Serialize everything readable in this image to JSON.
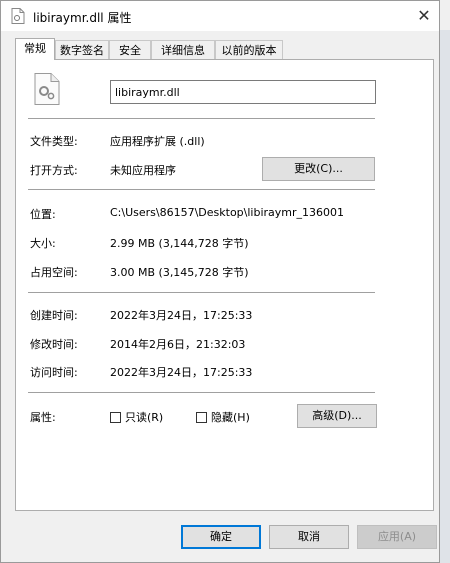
{
  "window": {
    "title": "libiraymr.dll 属性",
    "close_glyph": "✕"
  },
  "tabs": [
    {
      "label": "常规"
    },
    {
      "label": "数字签名"
    },
    {
      "label": "安全"
    },
    {
      "label": "详细信息"
    },
    {
      "label": "以前的版本"
    }
  ],
  "general": {
    "file_name": "libiraymr.dll",
    "file_type": {
      "label": "文件类型:",
      "value": "应用程序扩展 (.dll)"
    },
    "opens_with": {
      "label": "打开方式:",
      "value": "未知应用程序",
      "button": "更改(C)..."
    },
    "location": {
      "label": "位置:",
      "value": "C:\\Users\\86157\\Desktop\\libiraymr_136001"
    },
    "size": {
      "label": "大小:",
      "value": "2.99 MB (3,144,728 字节)"
    },
    "size_on_disk": {
      "label": "占用空间:",
      "value": "3.00 MB (3,145,728 字节)"
    },
    "created": {
      "label": "创建时间:",
      "value": "2022年3月24日，17:25:33"
    },
    "modified": {
      "label": "修改时间:",
      "value": "2014年2月6日，21:32:03"
    },
    "accessed": {
      "label": "访问时间:",
      "value": "2022年3月24日，17:25:33"
    },
    "attributes": {
      "label": "属性:",
      "readonly": "只读(R)",
      "hidden": "隐藏(H)",
      "advanced": "高级(D)..."
    }
  },
  "footer": {
    "ok": "确定",
    "cancel": "取消",
    "apply": "应用(A)"
  }
}
